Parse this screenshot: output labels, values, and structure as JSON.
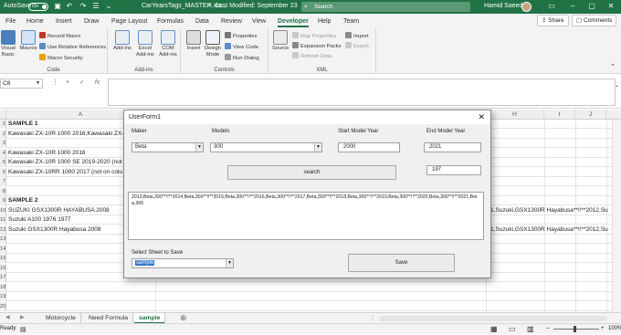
{
  "titlebar": {
    "autosave_label": "AutoSave",
    "autosave_state": "On",
    "file_title": "CarYearsTags_MASTER.xls...",
    "last_modified": "Last Modified: September 23",
    "search_placeholder": "Search",
    "user_name": "Hamid Saeed"
  },
  "ribbon_tabs": [
    "File",
    "Home",
    "Insert",
    "Draw",
    "Page Layout",
    "Formulas",
    "Data",
    "Review",
    "View",
    "Developer",
    "Help",
    "Team"
  ],
  "ribbon_actions": {
    "share": "Share",
    "comments": "Comments"
  },
  "ribbon": {
    "code": {
      "label": "Code",
      "visual_basic": "Visual Basic",
      "macros": "Macros",
      "record_macro": "Record Macro",
      "relative_refs": "Use Relative References",
      "macro_security": "Macro Security"
    },
    "addins": {
      "label": "Add-ins",
      "addins": "Add-ins",
      "excel_addins": "Excel Add-ins",
      "com_addins": "COM Add-ins"
    },
    "controls": {
      "label": "Controls",
      "insert": "Insert",
      "design_mode": "Design Mode",
      "properties": "Properties",
      "view_code": "View Code",
      "run_dialog": "Run Dialog"
    },
    "xml": {
      "label": "XML",
      "source": "Source",
      "map_properties": "Map Properties",
      "expansion_packs": "Expansion Packs",
      "refresh_data": "Refresh Data",
      "import": "Import",
      "export": "Export"
    }
  },
  "formula_bar": {
    "name_box": "C8",
    "fx": "fx",
    "cancel": "×",
    "enter": "✓"
  },
  "columns": [
    "A",
    "B",
    "C",
    "D",
    "E",
    "F",
    "G",
    "H",
    "I",
    "J"
  ],
  "rows": [
    {
      "n": "1",
      "a": "SAMPLE 1",
      "bold": true,
      "right": ""
    },
    {
      "n": "2",
      "a": "Kawasaki ZX-10R 1000 2016,Kawasaki ZX-1",
      "right": ""
    },
    {
      "n": "3",
      "a": "",
      "right": ""
    },
    {
      "n": "4",
      "a": "Kawasaki ZX-10R 1000 2016",
      "right": ""
    },
    {
      "n": "5",
      "a": "Kawasaki ZX-10R 1000 SE 2019-2020 (not c",
      "right": ""
    },
    {
      "n": "6",
      "a": "Kawasaki ZX-10RR 1000 2017 (not on colu",
      "right": ""
    },
    {
      "n": "7",
      "a": "",
      "right": ""
    },
    {
      "n": "8",
      "a": "",
      "right": ""
    },
    {
      "n": "9",
      "a": "SAMPLE 2",
      "bold": true,
      "right": ""
    },
    {
      "n": "10",
      "a": "SUZUKI  GSX1300R HAYABUSA 2008",
      "right": "11,Suzuki,GSX1300R Hayabusa**!!**2012,Su"
    },
    {
      "n": "11",
      "a": "Suzuki A100 1976 1977",
      "right": ""
    },
    {
      "n": "12",
      "a": "Suzuki GSX1300R Hayabusa 2008",
      "right": "11,Suzuki,GSX1300R Hayabusa**!!**2012,Su"
    },
    {
      "n": "13",
      "a": "",
      "right": ""
    },
    {
      "n": "14",
      "a": "",
      "right": ""
    },
    {
      "n": "15",
      "a": "",
      "right": ""
    },
    {
      "n": "16",
      "a": "",
      "right": ""
    },
    {
      "n": "17",
      "a": "",
      "right": ""
    },
    {
      "n": "18",
      "a": "",
      "right": ""
    },
    {
      "n": "19",
      "a": "",
      "right": ""
    },
    {
      "n": "20",
      "a": "",
      "right": ""
    }
  ],
  "sheet_tabs": [
    {
      "label": "Motorcycle",
      "active": false
    },
    {
      "label": "Need Formula",
      "active": false
    },
    {
      "label": "sample",
      "active": true
    }
  ],
  "status": {
    "ready": "Ready",
    "zoom": "100%"
  },
  "userform": {
    "title": "UserForm1",
    "maker_label": "Maker",
    "maker_value": "Beta",
    "models_label": "Models",
    "models_value": "300",
    "start_year_label": "Start Model Year",
    "start_year_value": "2000",
    "end_year_label": "End Model Year",
    "end_year_value": "2021",
    "count_value": "197",
    "search_button": "search",
    "output_text": "2013,Beta,300**!!**2014,Beta,300**!!**2015,Beta,300**!!**2016,Beta,300**!!**2017,Beta,300**!!**2018,Beta,300**!!**2019,Beta,300**!!**2020,Beta,300**!!**2021,Beta,300",
    "sheet_label": "Select Sheet to Save",
    "sheet_value": "sample",
    "save_button": "Save"
  }
}
